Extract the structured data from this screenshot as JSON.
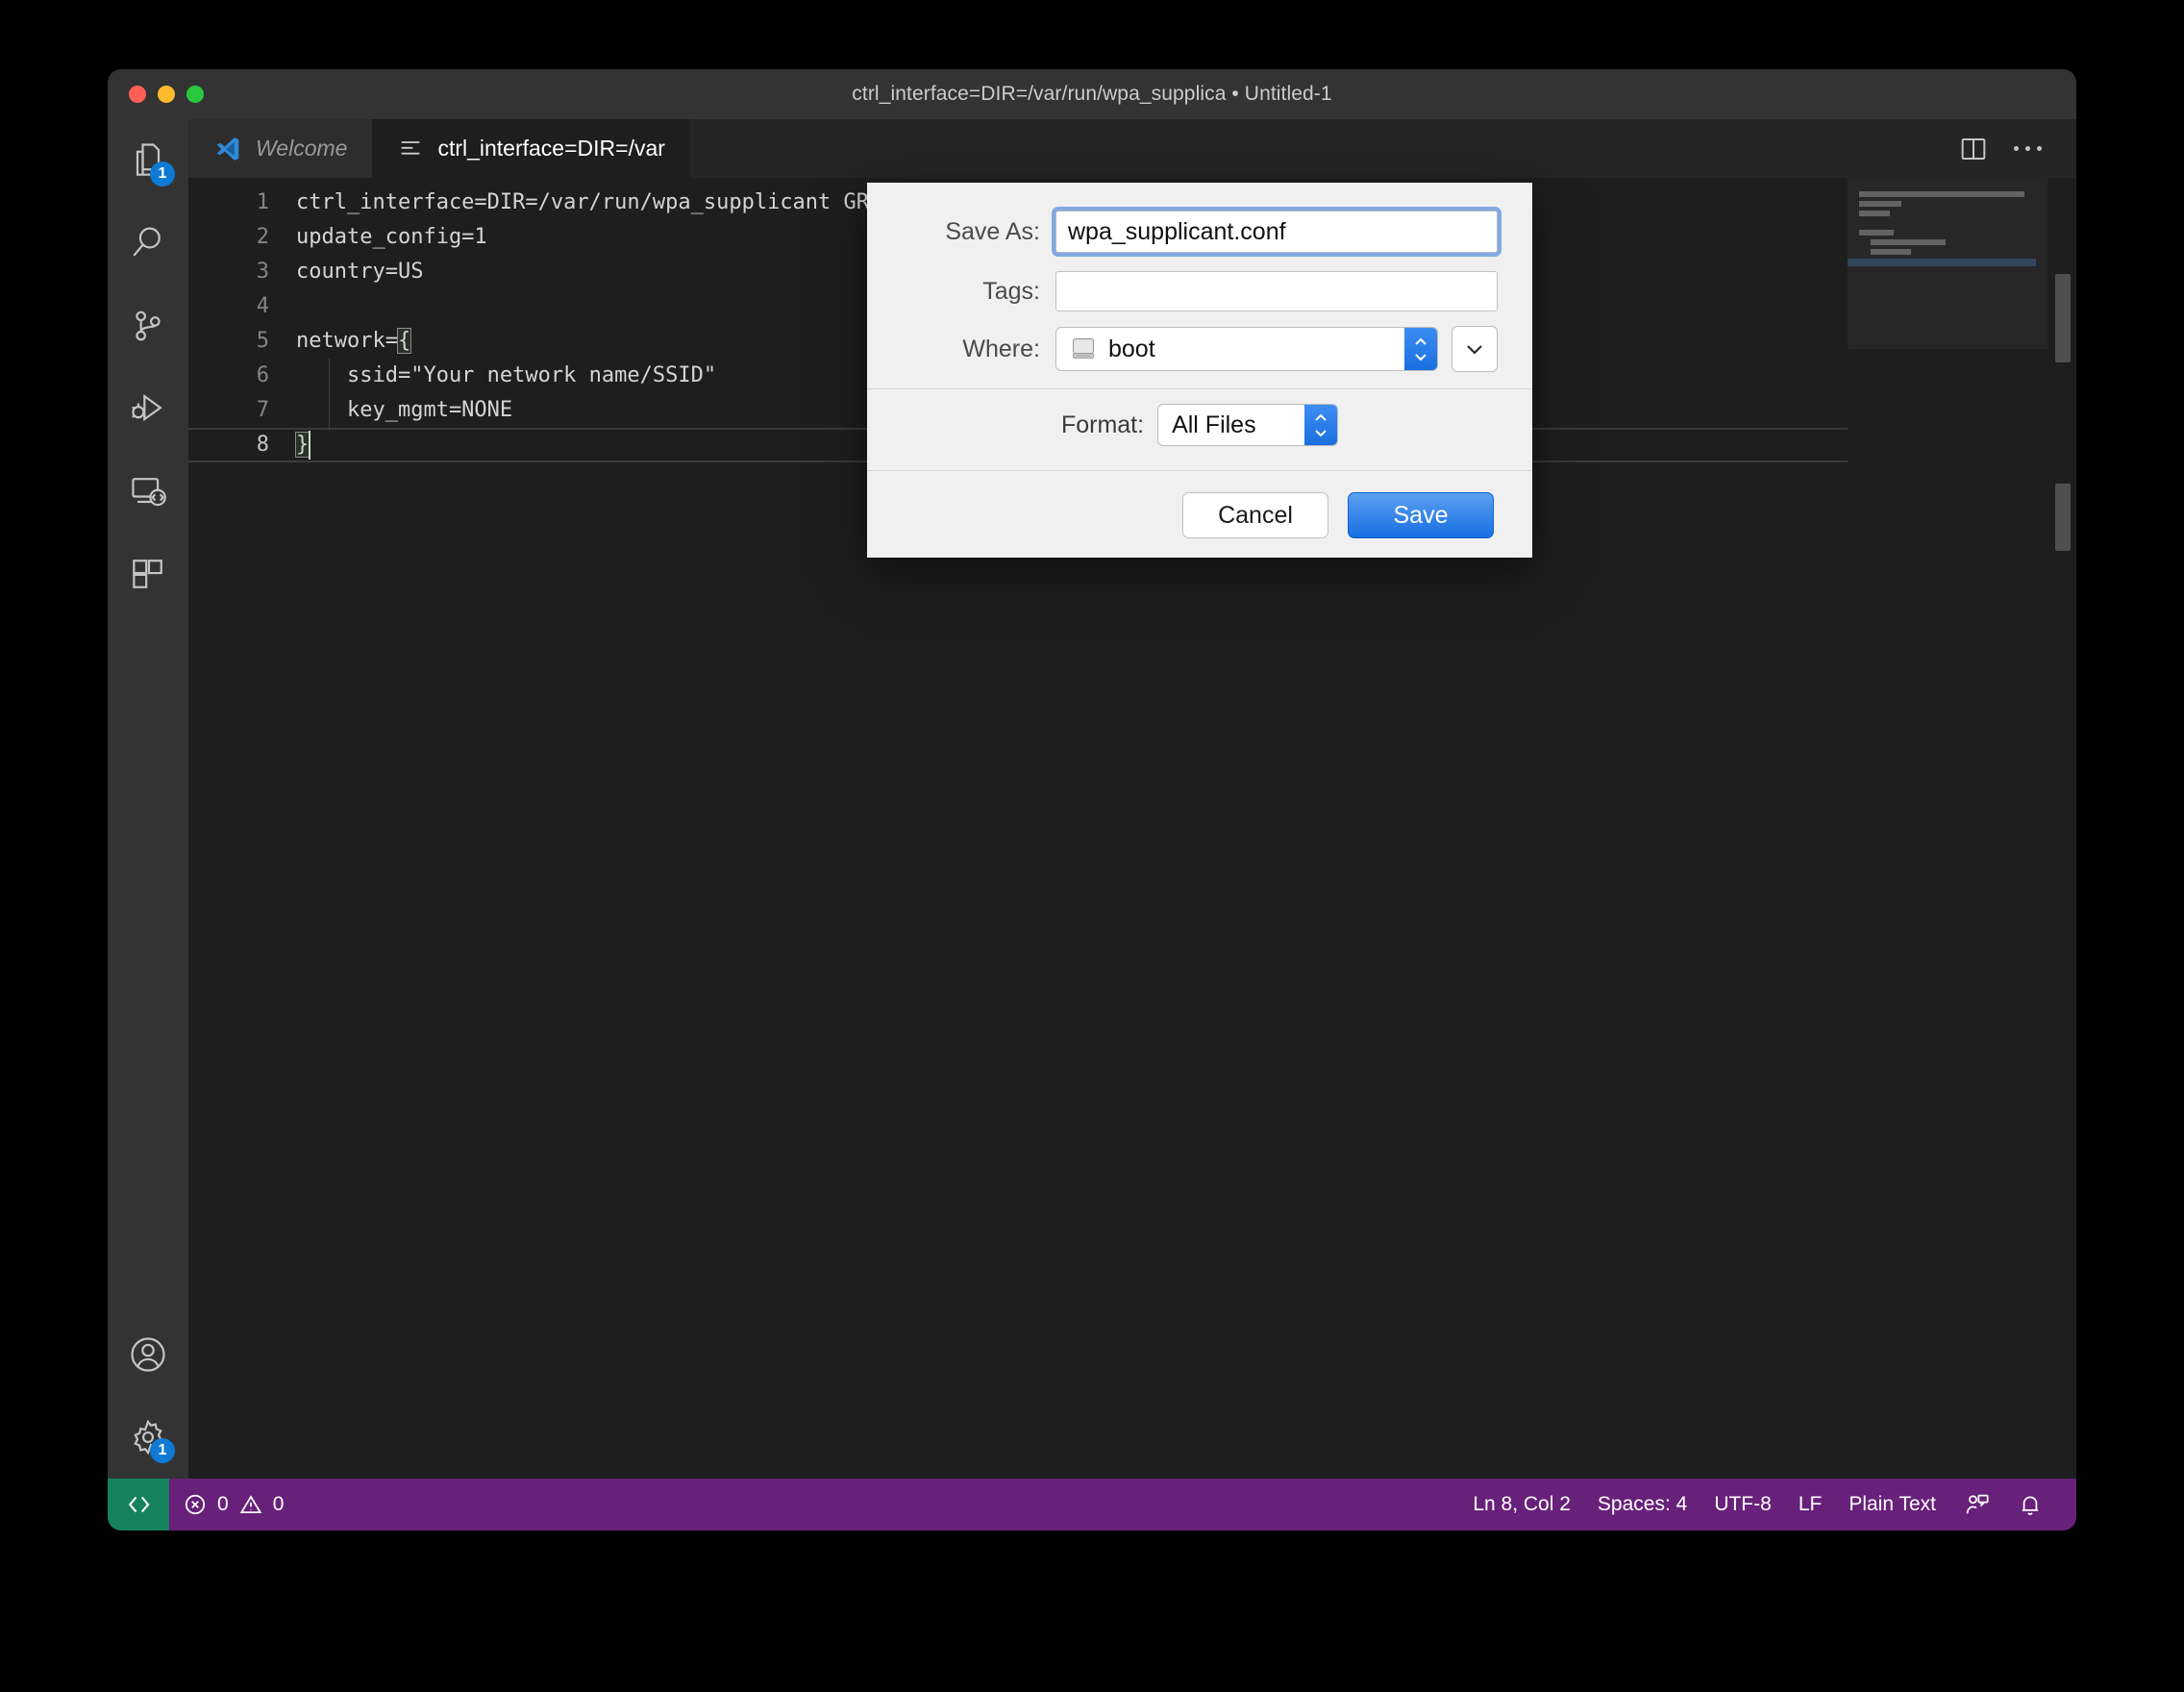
{
  "window": {
    "title": "ctrl_interface=DIR=/var/run/wpa_supplica • Untitled-1"
  },
  "activity_bar": {
    "items": [
      {
        "name": "explorer",
        "icon": "files-icon",
        "badge": "1"
      },
      {
        "name": "search",
        "icon": "search-icon",
        "badge": ""
      },
      {
        "name": "source-control",
        "icon": "source-control-icon",
        "badge": ""
      },
      {
        "name": "run-and-debug",
        "icon": "run-debug-icon",
        "badge": ""
      },
      {
        "name": "remote-explorer",
        "icon": "remote-explorer-icon",
        "badge": ""
      },
      {
        "name": "extensions",
        "icon": "extensions-icon",
        "badge": ""
      }
    ],
    "bottom_items": [
      {
        "name": "accounts",
        "icon": "account-icon",
        "badge": ""
      },
      {
        "name": "settings",
        "icon": "gear-icon",
        "badge": "1"
      }
    ]
  },
  "tabs": [
    {
      "label": "Welcome",
      "icon": "vscode-logo-icon",
      "active": false
    },
    {
      "label": "ctrl_interface=DIR=/var",
      "icon": "plaintext-file-icon",
      "active": true
    }
  ],
  "editor_actions": {
    "split_label": "split-editor",
    "more_label": "more-actions"
  },
  "editor": {
    "lines": [
      {
        "number": "1",
        "text": "ctrl_interface=DIR=/var/run/wpa_supplicant GROUP=netdev"
      },
      {
        "number": "2",
        "text": "update_config=1"
      },
      {
        "number": "3",
        "text": "country=US"
      },
      {
        "number": "4",
        "text": ""
      },
      {
        "number": "5",
        "text": "network={"
      },
      {
        "number": "6",
        "text": "    ssid=\"Your network name/SSID\""
      },
      {
        "number": "7",
        "text": "    key_mgmt=NONE"
      },
      {
        "number": "8",
        "text": "}"
      }
    ]
  },
  "status_bar": {
    "remote_icon": "remote-indicator-icon",
    "errors_icon": "error-icon",
    "errors": "0",
    "warnings_icon": "warning-icon",
    "warnings": "0",
    "position": "Ln 8, Col 2",
    "indentation": "Spaces: 4",
    "encoding": "UTF-8",
    "eol": "LF",
    "language": "Plain Text",
    "feedback_icon": "feedback-icon",
    "bell_icon": "bell-icon"
  },
  "dialog": {
    "save_as_label": "Save As:",
    "file_name": "wpa_supplicant.conf",
    "tags_label": "Tags:",
    "tags_value": "",
    "where_label": "Where:",
    "where_value": "boot",
    "where_icon": "disk-icon",
    "format_label": "Format:",
    "format_value": "All Files",
    "cancel_label": "Cancel",
    "save_label": "Save"
  },
  "colors": {
    "status_bar": "#68217a",
    "remote_indicator": "#16825d",
    "accent_blue": "#0e7ad4",
    "editor_bg": "#1e1e1e"
  }
}
